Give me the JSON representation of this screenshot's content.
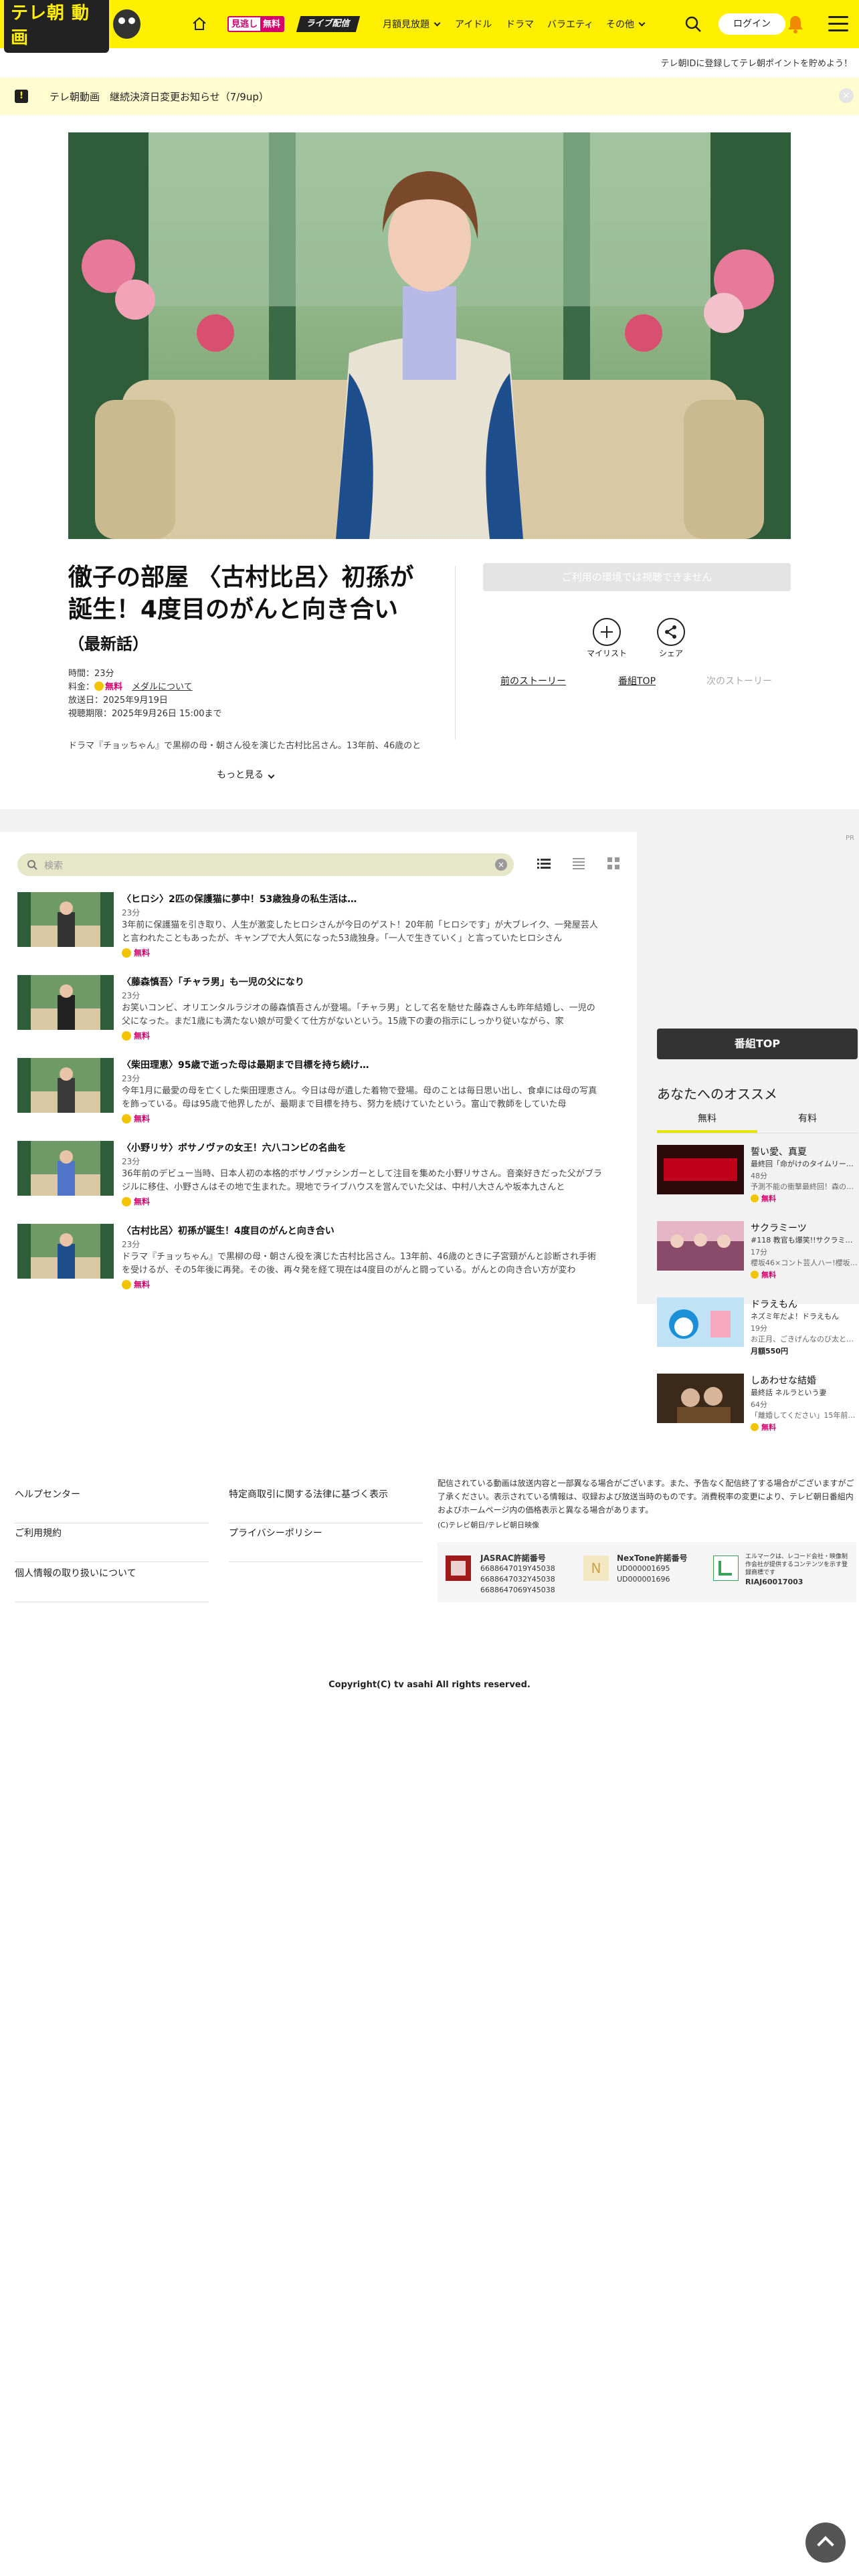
{
  "header": {
    "logo_text": "テレ朝 動画",
    "badge_mitai": "見逃し",
    "badge_free": "無料",
    "badge_live": "ライブ配信",
    "nav": [
      "月額見放題",
      "アイドル",
      "ドラマ",
      "バラエティ",
      "その他"
    ],
    "login": "ログイン",
    "register_text": "テレ朝IDに登録してテレ朝ポイントを貯めよう！"
  },
  "notice": {
    "text": "テレ朝動画　継続決済日変更お知らせ（7/9up）",
    "close": "×"
  },
  "program": {
    "title": "徹子の部屋 〈古村比呂〉初孫が誕生！4度目のがんと向き合い",
    "subtitle": "（最新話）",
    "duration": "時間：23分",
    "price_label": "料金：",
    "price": "無料",
    "medal": "メダルについて",
    "airdate": "放送日：2025年9月19日",
    "period": "視聴期限：2025年9月26日 15:00まで",
    "description": "ドラマ『チョッちゃん』で黒柳の母・朝さん役を演じた古村比呂さん。13年前、46歳のと",
    "more": "もっと見る",
    "unavailable": "ご利用の環境では視聴できません",
    "mylist": "マイリスト",
    "share": "シェア",
    "prev_story": "前のストーリー",
    "program_top": "番組TOP",
    "next_story": "次のストーリー"
  },
  "ad_mark": "PR",
  "episodes_panel": {
    "search_placeholder": "検索",
    "clear": "×",
    "items": [
      {
        "title": "〈ヒロシ〉2匹の保護猫に夢中！53歳独身の私生活は…",
        "duration": "23分",
        "text": "3年前に保護猫を引き取り、人生が激変したヒロシさんが今日のゲスト！20年前「ヒロシです」が大ブレイク、一発屋芸人と言われたこともあったが、キャンプで大人気になった53歳独身。「一人で生きていく」と言っていたヒロシさん",
        "free": "無料"
      },
      {
        "title": "〈藤森慎吾〉「チャラ男」も一児の父になり",
        "duration": "23分",
        "text": "お笑いコンビ、オリエンタルラジオの藤森慎吾さんが登場。「チャラ男」として名を馳せた藤森さんも昨年結婚し、一児の父になった。まだ1歳にも満たない娘が可愛くて仕方がないという。15歳下の妻の指示にしっかり従いながら、家",
        "free": "無料"
      },
      {
        "title": "〈柴田理恵〉95歳で逝った母は最期まで目標を持ち続け…",
        "duration": "23分",
        "text": "今年1月に最愛の母を亡くした柴田理恵さん。今日は母が遺した着物で登場。母のことは毎日思い出し、食卓には母の写真を飾っている。母は95歳で他界したが、最期まで目標を持ち、努力を続けていたという。富山で教師をしていた母",
        "free": "無料"
      },
      {
        "title": "〈小野リサ〉ボサノヴァの女王！六八コンビの名曲を",
        "duration": "23分",
        "text": "36年前のデビュー当時、日本人初の本格的ボサノヴァシンガーとして注目を集めた小野リサさん。音楽好きだった父がブラジルに移住、小野さんはその地で生まれた。現地でライブハウスを営んでいた父は、中村八大さんや坂本九さんと",
        "free": "無料"
      },
      {
        "title": "〈古村比呂〉初孫が誕生！4度目のがんと向き合い",
        "duration": "23分",
        "text": "ドラマ『チョッちゃん』で黒柳の母・朝さん役を演じた古村比呂さん。13年前、46歳のときに子宮頸がんと診断され手術を受けるが、その5年後に再発。その後、再々発を経て現在は4度目のがんと闘っている。がんとの向き合い方が変わ",
        "free": "無料"
      }
    ]
  },
  "sidebar": {
    "program_top": "番組TOP",
    "rec_title": "あなたへのオススメ",
    "tab_free": "無料",
    "tab_paid": "有料",
    "items": [
      {
        "title": "誓い愛、真夏",
        "sub": "最終回「命がけのタイムリー…",
        "dur": "48分",
        "text": "予測不能の衝撃最終回！森の…",
        "price": "無料",
        "paid": false
      },
      {
        "title": "サクラミーツ",
        "sub": "#118 教官も爆笑!!サクラミ…",
        "dur": "17分",
        "text": "櫻坂46×コント芸人ハー!櫻坂…",
        "price": "無料",
        "paid": false
      },
      {
        "title": "ドラえもん",
        "sub": "ネズミ年だよ！ドラえもん",
        "dur": "19分",
        "text": "お正月、ごきげんなのび太と…",
        "price": "月額550円",
        "paid": true
      },
      {
        "title": "しあわせな結婚",
        "sub": "最終話 ネルラという妻",
        "dur": "64分",
        "text": "「離婚してください」15年前…",
        "price": "無料",
        "paid": false
      }
    ]
  },
  "footer": {
    "links_left": [
      "ヘルプセンター",
      "ご利用規約",
      "個人情報の取り扱いについて"
    ],
    "links_right": [
      "特定商取引に関する法律に基づく表示",
      "プライバシーポリシー"
    ],
    "note": "配信されている動画は放送内容と一部異なる場合がございます。また、予告なく配信終了する場合がございますがご了承ください。表示されている情報は、収録および放送当時のものです。消費税率の変更により、テレビ朝日番組内およびホームページ内の価格表示と異なる場合があります。",
    "image_credit": "(C)テレビ朝日/テレビ朝日映像",
    "jasrac_title": "JASRAC許諾番号",
    "jasrac_nums": [
      "6688647019Y45038",
      "6688647032Y45038",
      "6688647069Y45038"
    ],
    "nextone_title": "NexTone許諾番号",
    "nextone_nums": [
      "UD000001695",
      "UD000001696"
    ],
    "lmark_text": "エルマークは、レコード会社・映像制作会社が提供するコンテンツを示す登録商標です",
    "lmark_num": "RIAJ60017003",
    "copyright": "Copyright(C) tv asahi All rights reserved."
  }
}
